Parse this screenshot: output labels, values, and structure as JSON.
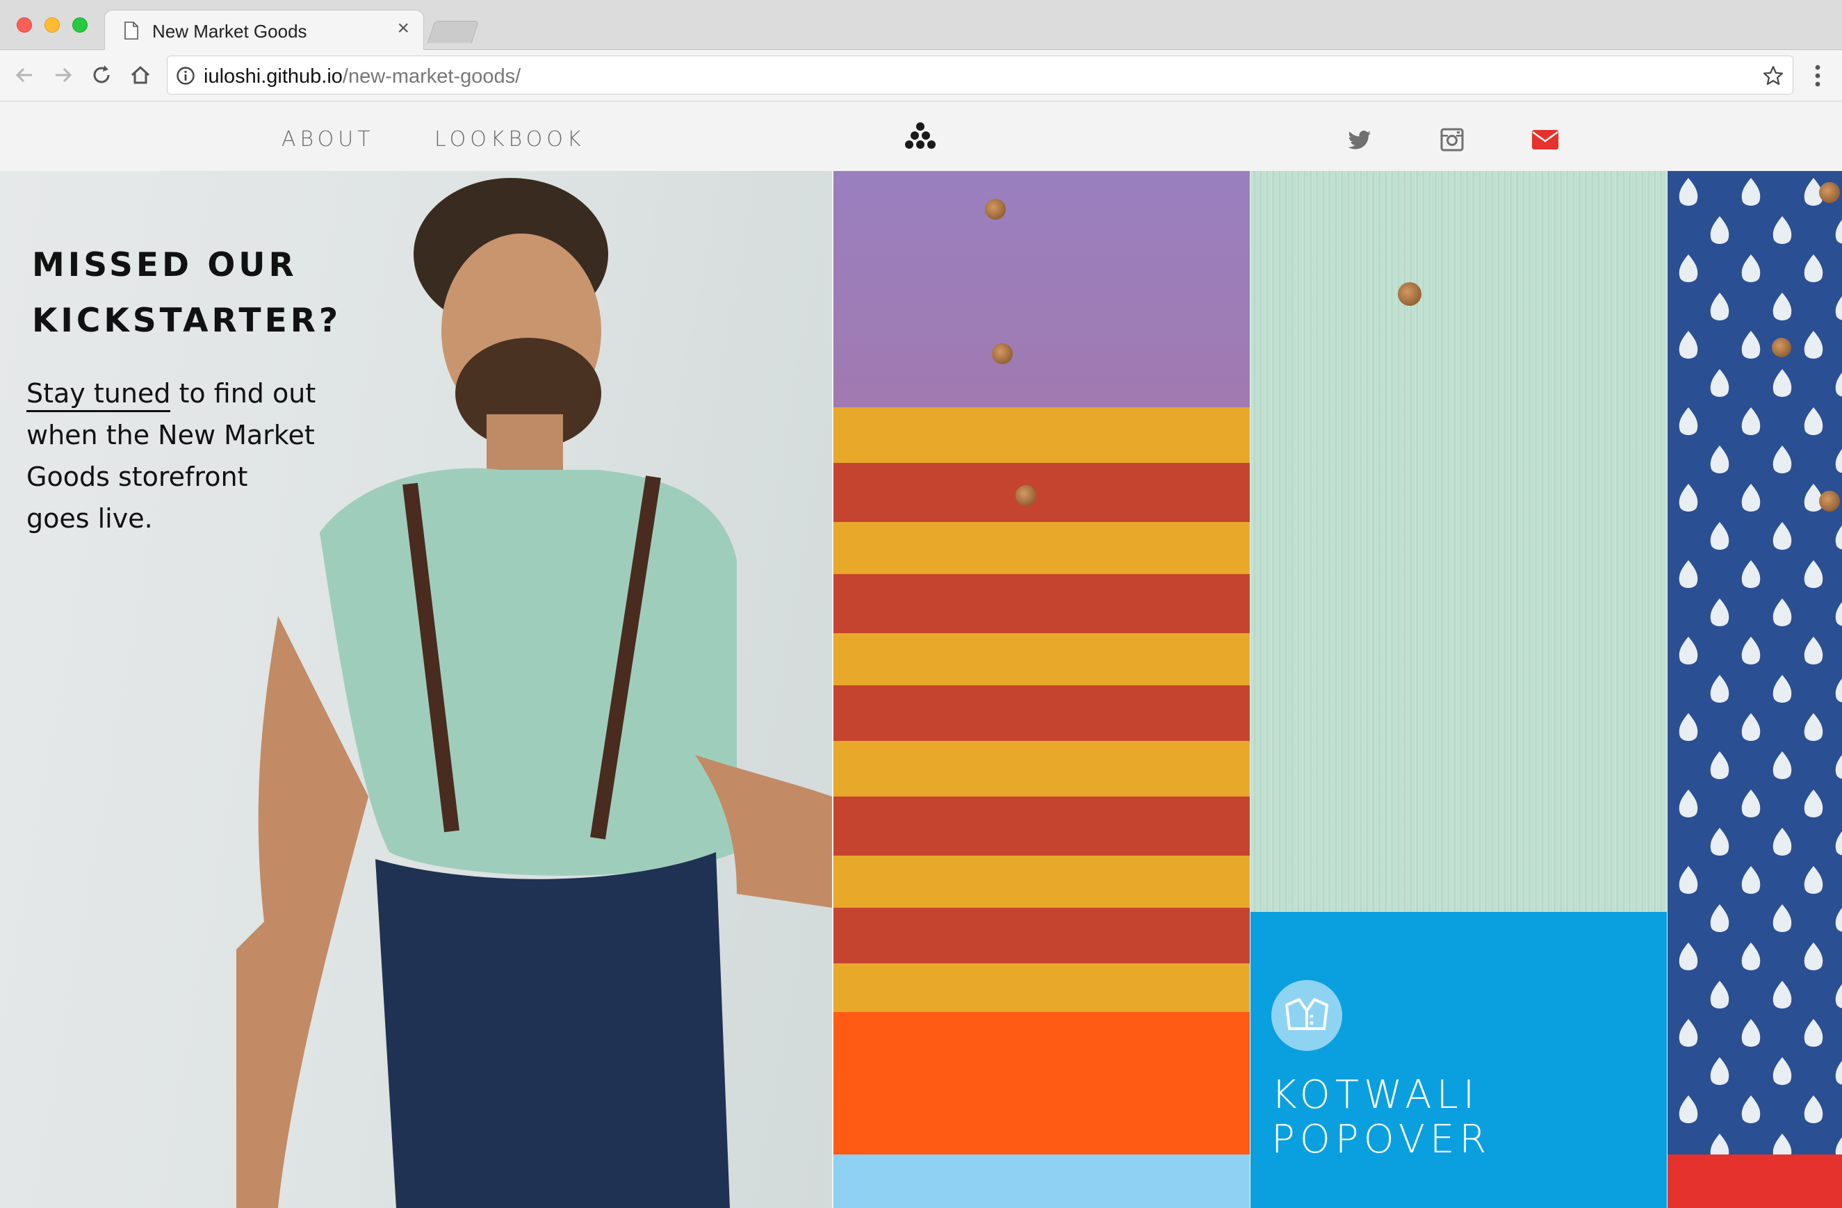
{
  "browser": {
    "tab_title": "New Market Goods",
    "tab_close": "×",
    "url_host": "iuloshi.github.io",
    "url_path": "/new-market-goods/",
    "icons": [
      "back-icon",
      "forward-icon",
      "reload-icon",
      "home-icon",
      "info-icon",
      "star-icon",
      "menu-icon"
    ]
  },
  "header": {
    "nav": [
      {
        "label": "ABOUT"
      },
      {
        "label": "LOOKBOOK"
      }
    ],
    "social_icons": [
      "twitter-icon",
      "instagram-icon",
      "mail-icon"
    ],
    "accent_color": "#e5322d"
  },
  "hero": {
    "title_line1": "MISSED OUR",
    "title_line2": "KICKSTARTER?",
    "link_text": "Stay tuned",
    "body_rest_1": " to find out",
    "body_line2": "when the New Market",
    "body_line3": "Goods storefront",
    "body_line4": "goes live."
  },
  "feature": {
    "title_line1": "KOTWALI",
    "title_line2": "POPOVER",
    "color": "#0aa0df"
  }
}
